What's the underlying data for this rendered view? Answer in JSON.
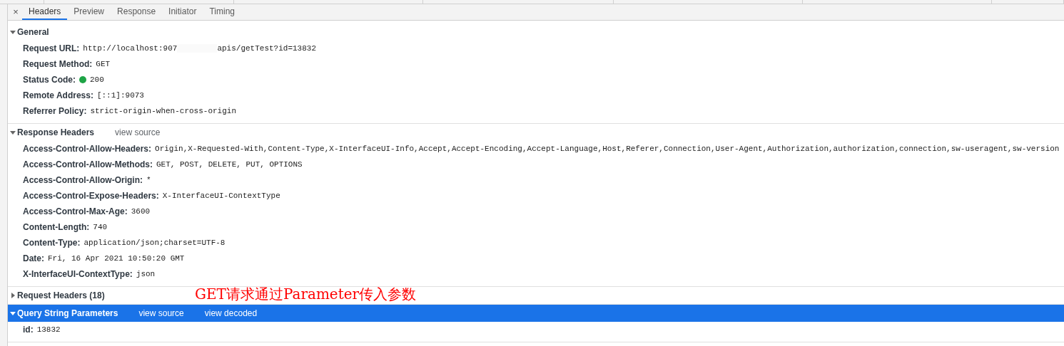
{
  "tabs": [
    {
      "label": "Headers",
      "selected": true
    },
    {
      "label": "Preview",
      "selected": false
    },
    {
      "label": "Response",
      "selected": false
    },
    {
      "label": "Initiator",
      "selected": false
    },
    {
      "label": "Timing",
      "selected": false
    }
  ],
  "close_icon": "×",
  "sections": [
    {
      "title": "General",
      "expanded": true,
      "selected": false,
      "rows": [
        {
          "kind": "text",
          "name": "Request URL:",
          "value": "http://localhost:907",
          "value_after_redaction": "apis/getTest?id=13832"
        },
        {
          "kind": "text",
          "name": "Request Method:",
          "value": "GET"
        },
        {
          "kind": "status",
          "name": "Status Code:",
          "value": "200"
        },
        {
          "kind": "text",
          "name": "Remote Address:",
          "value": "[::1]:9073"
        },
        {
          "kind": "text",
          "name": "Referrer Policy:",
          "value": "strict-origin-when-cross-origin"
        }
      ]
    },
    {
      "title": "Response Headers",
      "expanded": true,
      "selected": false,
      "links": [
        "view source"
      ],
      "rows": [
        {
          "name": "Access-Control-Allow-Headers:",
          "value": "Origin,X-Requested-With,Content-Type,X-InterfaceUI-Info,Accept,Accept-Encoding,Accept-Language,Host,Referer,Connection,User-Agent,Authorization,authorization,connection,sw-useragent,sw-version"
        },
        {
          "name": "Access-Control-Allow-Methods:",
          "value": "GET, POST, DELETE, PUT, OPTIONS"
        },
        {
          "name": "Access-Control-Allow-Origin:",
          "value": "*"
        },
        {
          "name": "Access-Control-Expose-Headers:",
          "value": "X-InterfaceUI-ContextType"
        },
        {
          "name": "Access-Control-Max-Age:",
          "value": "3600"
        },
        {
          "name": "Content-Length:",
          "value": "740"
        },
        {
          "name": "Content-Type:",
          "value": "application/json;charset=UTF-8"
        },
        {
          "name": "Date:",
          "value": "Fri, 16 Apr 2021 10:50:20 GMT"
        },
        {
          "name": "X-InterfaceUI-ContextType:",
          "value": "json"
        }
      ]
    },
    {
      "title": "Request Headers (18)",
      "expanded": false,
      "selected": false
    },
    {
      "title": "Query String Parameters",
      "expanded": true,
      "selected": true,
      "links": [
        "view source",
        "view decoded"
      ],
      "rows": [
        {
          "name": "id:",
          "value": "13832"
        }
      ]
    }
  ],
  "annotation": "GET请求通过Parameter传入参数"
}
